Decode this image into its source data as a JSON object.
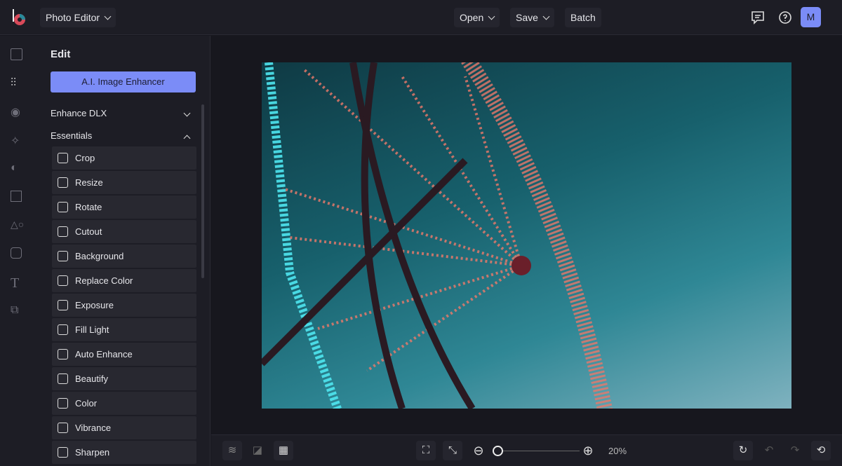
{
  "header": {
    "app_menu": "Photo Editor",
    "open": "Open",
    "save": "Save",
    "batch": "Batch",
    "avatar": "M"
  },
  "panel": {
    "title": "Edit",
    "ai_button": "A.I. Image Enhancer",
    "sections": [
      "Enhance DLX",
      "Essentials"
    ],
    "items": [
      "Crop",
      "Resize",
      "Rotate",
      "Cutout",
      "Background",
      "Replace Color",
      "Exposure",
      "Fill Light",
      "Auto Enhance",
      "Beautify",
      "Color",
      "Vibrance",
      "Sharpen"
    ]
  },
  "bottom": {
    "zoom": "20%"
  },
  "colors": {
    "accent": "#7b8cf7"
  }
}
